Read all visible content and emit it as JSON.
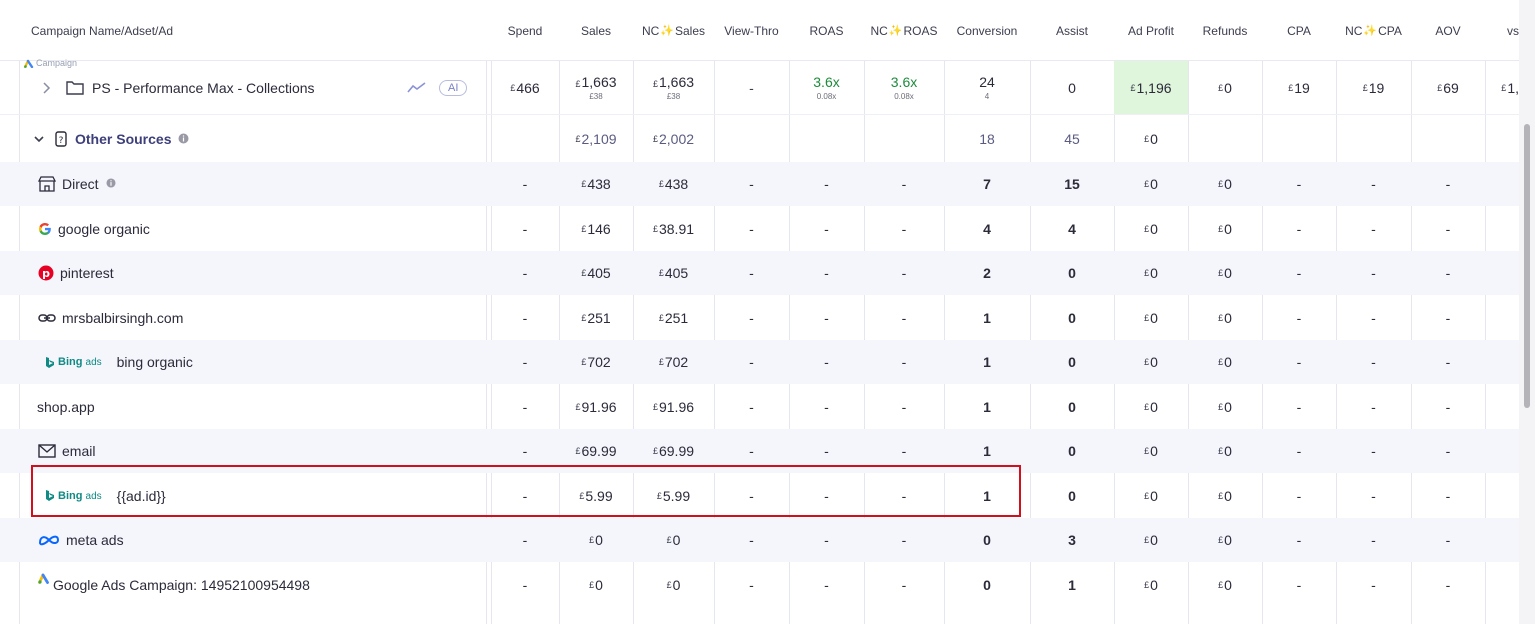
{
  "columns": [
    "Campaign Name/Adset/Ad",
    "Spend",
    "Sales",
    "NC ✨ Sales",
    "View-Thro",
    "ROAS",
    "NC ✨ ROAS",
    "Conversion",
    "Assist",
    "Ad Profit",
    "Refunds",
    "CPA",
    "NC ✨ CPA",
    "AOV",
    "vs"
  ],
  "header_labels": {
    "name": "Campaign Name/Adset/Ad",
    "spend": "Spend",
    "sales": "Sales",
    "nc_sales_prefix": "NC",
    "nc_sales_suffix": "Sales",
    "view_thro": "View-Thro",
    "roas": "ROAS",
    "nc_roas_prefix": "NC",
    "nc_roas_suffix": "ROAS",
    "conversion": "Conversion",
    "assist": "Assist",
    "ad_profit": "Ad Profit",
    "refunds": "Refunds",
    "cpa": "CPA",
    "nc_cpa_prefix": "NC",
    "nc_cpa_suffix": "CPA",
    "aov": "AOV",
    "vs": "vs"
  },
  "currency": "£",
  "campaign_row": {
    "tag": "Campaign",
    "name": "PS - Performance Max - Collections",
    "ai_badge": "AI",
    "spend": "466",
    "sales": "1,663",
    "sales_sub": "£38",
    "nc_sales": "1,663",
    "nc_sales_sub": "£38",
    "view_thro": "-",
    "roas": "3.6x",
    "roas_sub": "0.08x",
    "nc_roas": "3.6x",
    "nc_roas_sub": "0.08x",
    "conversion": "24",
    "conversion_sub": "4",
    "assist": "0",
    "ad_profit": "1,196",
    "refunds": "0",
    "cpa": "19",
    "nc_cpa": "19",
    "aov": "69",
    "vs": "1,"
  },
  "other_sources": {
    "label": "Other Sources",
    "sales": "2,109",
    "nc_sales": "2,002",
    "conversion": "18",
    "assist": "45",
    "ad_profit": "0"
  },
  "rows": [
    {
      "name": "Direct",
      "icon": "store-icon",
      "spend": "-",
      "sales": "438",
      "nc_sales": "438",
      "view_thro": "-",
      "roas": "-",
      "nc_roas": "-",
      "conversion": "7",
      "assist": "15",
      "ad_profit": "0",
      "refunds": "0",
      "cpa": "-",
      "nc_cpa": "-",
      "aov": "-"
    },
    {
      "name": "google organic",
      "icon": "google-icon",
      "spend": "-",
      "sales": "146",
      "nc_sales": "38.91",
      "view_thro": "-",
      "roas": "-",
      "nc_roas": "-",
      "conversion": "4",
      "assist": "4",
      "ad_profit": "0",
      "refunds": "0",
      "cpa": "-",
      "nc_cpa": "-",
      "aov": "-"
    },
    {
      "name": "pinterest",
      "icon": "pinterest-icon",
      "spend": "-",
      "sales": "405",
      "nc_sales": "405",
      "view_thro": "-",
      "roas": "-",
      "nc_roas": "-",
      "conversion": "2",
      "assist": "0",
      "ad_profit": "0",
      "refunds": "0",
      "cpa": "-",
      "nc_cpa": "-",
      "aov": "-"
    },
    {
      "name": "mrsbalbirsingh.com",
      "icon": "link-icon",
      "spend": "-",
      "sales": "251",
      "nc_sales": "251",
      "view_thro": "-",
      "roas": "-",
      "nc_roas": "-",
      "conversion": "1",
      "assist": "0",
      "ad_profit": "0",
      "refunds": "0",
      "cpa": "-",
      "nc_cpa": "-",
      "aov": "-"
    },
    {
      "name": "bing organic",
      "icon": "bing-ads-icon",
      "spend": "-",
      "sales": "702",
      "nc_sales": "702",
      "view_thro": "-",
      "roas": "-",
      "nc_roas": "-",
      "conversion": "1",
      "assist": "0",
      "ad_profit": "0",
      "refunds": "0",
      "cpa": "-",
      "nc_cpa": "-",
      "aov": "-"
    },
    {
      "name": "shop.app",
      "icon": "",
      "spend": "-",
      "sales": "91.96",
      "nc_sales": "91.96",
      "view_thro": "-",
      "roas": "-",
      "nc_roas": "-",
      "conversion": "1",
      "assist": "0",
      "ad_profit": "0",
      "refunds": "0",
      "cpa": "-",
      "nc_cpa": "-",
      "aov": "-"
    },
    {
      "name": "email",
      "icon": "mail-icon",
      "spend": "-",
      "sales": "69.99",
      "nc_sales": "69.99",
      "view_thro": "-",
      "roas": "-",
      "nc_roas": "-",
      "conversion": "1",
      "assist": "0",
      "ad_profit": "0",
      "refunds": "0",
      "cpa": "-",
      "nc_cpa": "-",
      "aov": "-"
    },
    {
      "name": "{{ad.id}}",
      "icon": "bing-ads-icon",
      "spend": "-",
      "sales": "5.99",
      "nc_sales": "5.99",
      "view_thro": "-",
      "roas": "-",
      "nc_roas": "-",
      "conversion": "1",
      "assist": "0",
      "ad_profit": "0",
      "refunds": "0",
      "cpa": "-",
      "nc_cpa": "-",
      "aov": "-"
    },
    {
      "name": "meta ads",
      "icon": "meta-icon",
      "spend": "-",
      "sales": "0",
      "nc_sales": "0",
      "view_thro": "-",
      "roas": "-",
      "nc_roas": "-",
      "conversion": "0",
      "assist": "3",
      "ad_profit": "0",
      "refunds": "0",
      "cpa": "-",
      "nc_cpa": "-",
      "aov": "-"
    },
    {
      "name": "Google Ads Campaign: 14952100954498",
      "icon": "google-ads-icon",
      "spend": "-",
      "sales": "0",
      "nc_sales": "0",
      "view_thro": "-",
      "roas": "-",
      "nc_roas": "-",
      "conversion": "0",
      "assist": "1",
      "ad_profit": "0",
      "refunds": "0",
      "cpa": "-",
      "nc_cpa": "-",
      "aov": "-"
    }
  ],
  "bing_label": {
    "brand": "Bing",
    "suffix": "ads"
  },
  "colors": {
    "highlight_border": "#d20f1c",
    "profit_positive": "#dff5dc",
    "roas_green": "#1f8a3d",
    "section_label": "#3d3f7a"
  }
}
